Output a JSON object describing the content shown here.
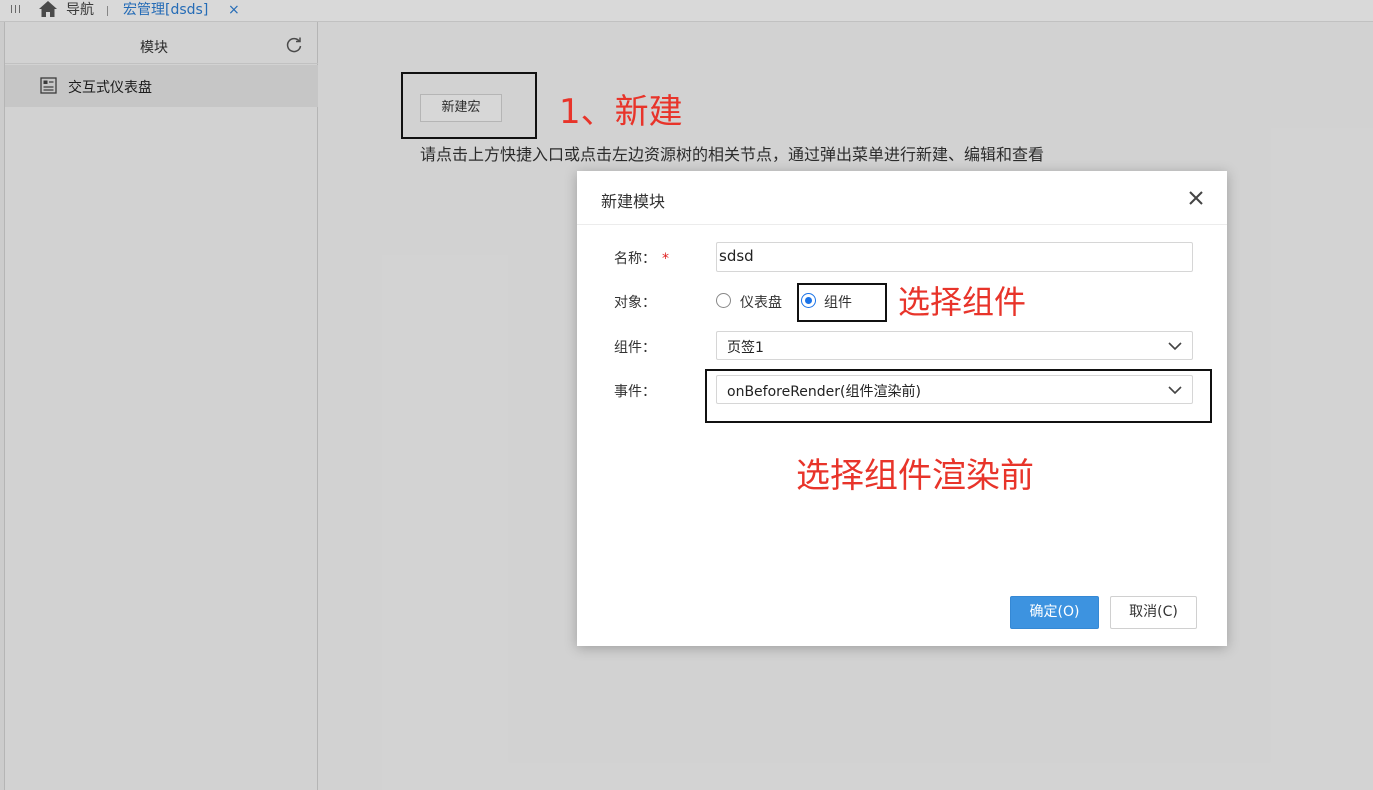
{
  "topbar": {
    "nav_label": "导航",
    "tab_label": "宏管理[dsds]",
    "tab_close": "×"
  },
  "sidebar": {
    "title": "模块",
    "items": [
      {
        "label": "交互式仪表盘"
      }
    ]
  },
  "main": {
    "new_macro_button": "新建宏",
    "hint": "请点击上方快捷入口或点击左边资源树的相关节点，通过弹出菜单进行新建、编辑和查看"
  },
  "dialog": {
    "title": "新建模块",
    "name_label": "名称：",
    "name_required": "*",
    "name_value": "sdsd",
    "object_label": "对象：",
    "object_options": [
      {
        "label": "仪表盘",
        "checked": false
      },
      {
        "label": "组件",
        "checked": true
      }
    ],
    "component_label": "组件：",
    "component_value": "页签1",
    "event_label": "事件：",
    "event_value": "onBeforeRender(组件渲染前)",
    "ok_button": "确定(O)",
    "cancel_button": "取消(C)"
  },
  "annotations": {
    "step1": "1、新建",
    "select_component": "选择组件",
    "select_event": "选择组件渲染前"
  },
  "colors": {
    "accent": "#3d93e0",
    "annotation": "#e8342a",
    "tab_active": "#2b7bd0"
  }
}
